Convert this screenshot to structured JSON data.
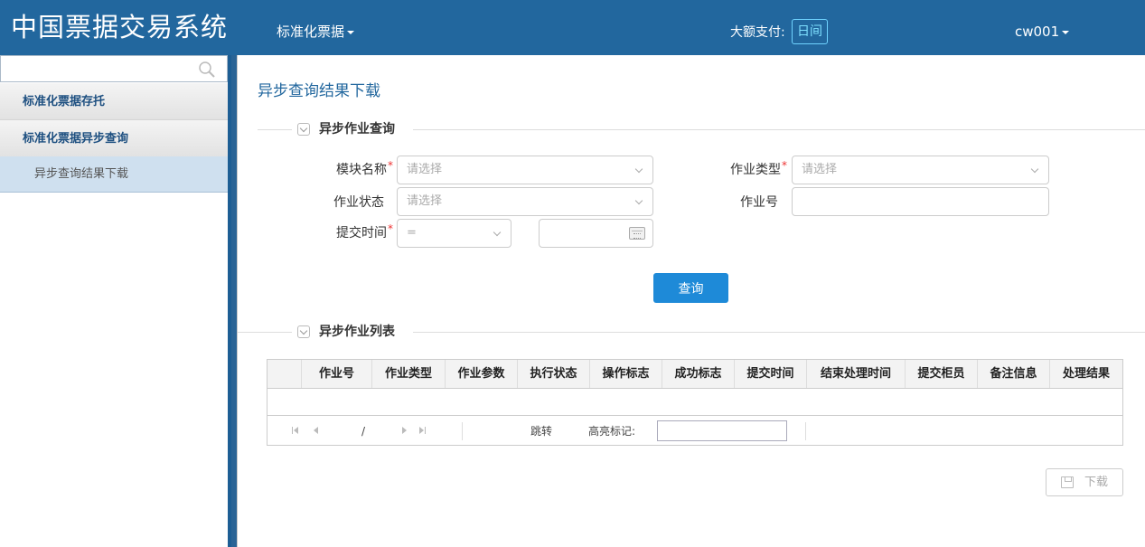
{
  "header": {
    "app_title": "中国票据交易系统",
    "nav_menu": "标准化票据",
    "pay_label": "大额支付:",
    "pay_mode": "日间",
    "user": "cw001"
  },
  "sidebar": {
    "search_placeholder": "",
    "items": [
      {
        "label": "标准化票据存托"
      },
      {
        "label": "标准化票据异步查询"
      },
      {
        "label": "异步查询结果下载"
      }
    ]
  },
  "main": {
    "page_title": "异步查询结果下载",
    "query_section": {
      "title": "异步作业查询",
      "module_name": {
        "label": "模块名称",
        "required": "*",
        "placeholder": "请选择"
      },
      "job_type": {
        "label": "作业类型",
        "required": "*",
        "placeholder": "请选择"
      },
      "job_status": {
        "label": "作业状态",
        "placeholder": "请选择"
      },
      "job_no": {
        "label": "作业号",
        "value": ""
      },
      "submit_time": {
        "label": "提交时间",
        "required": "*",
        "operator": "=",
        "date": ""
      },
      "query_button": "查询"
    },
    "list_section": {
      "title": "异步作业列表",
      "columns": [
        "作业号",
        "作业类型",
        "作业参数",
        "执行状态",
        "操作标志",
        "成功标志",
        "提交时间",
        "结束处理时间",
        "提交柜员",
        "备注信息",
        "处理结果"
      ],
      "rows": [],
      "pager": {
        "page_separator": "/",
        "jump_label": "跳转",
        "highlight_label": "高亮标记:"
      },
      "download_button": "下载"
    }
  },
  "colors": {
    "header_bg": "#22679e",
    "accent": "#1e8ad8",
    "required": "#ee3333",
    "pay_mode": "#7fe0ff"
  }
}
